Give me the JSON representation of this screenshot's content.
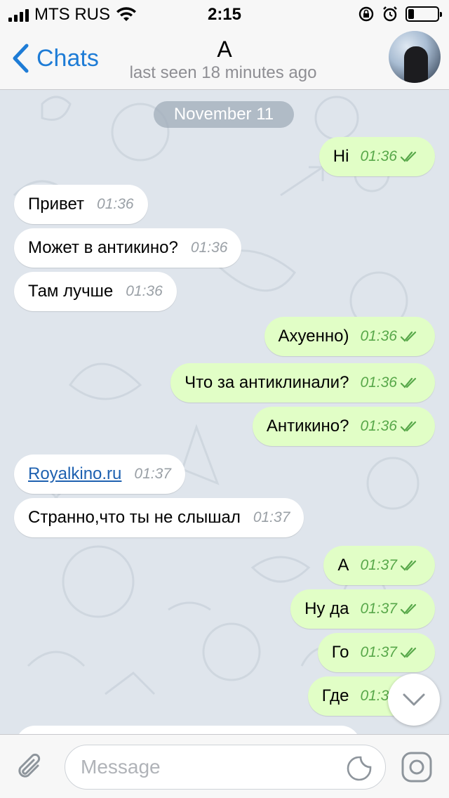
{
  "status_bar": {
    "carrier": "MTS RUS",
    "time": "2:15",
    "wifi_icon": "wifi-icon",
    "rotation_lock_icon": "rotation-lock-icon",
    "alarm_icon": "alarm-icon",
    "battery_level": 0.2
  },
  "nav": {
    "back_label": "Chats",
    "title": "А",
    "subtitle": "last seen 18 minutes ago"
  },
  "date_separator": "November 11",
  "messages": [
    {
      "dir": "out",
      "text": "Hi",
      "time": "01:36",
      "read": true
    },
    {
      "dir": "in",
      "text": "Привет",
      "time": "01:36"
    },
    {
      "dir": "in",
      "text": "Может в антикино?",
      "time": "01:36"
    },
    {
      "dir": "in",
      "text": "Там лучше",
      "time": "01:36"
    },
    {
      "dir": "out",
      "text": "Ахуенно)",
      "time": "01:36",
      "read": true
    },
    {
      "dir": "out",
      "text": "Что за антиклинали?",
      "time": "01:36",
      "read": true
    },
    {
      "dir": "out",
      "text": "Антикино?",
      "time": "01:36",
      "read": true
    },
    {
      "dir": "in",
      "text": "Royalkino.ru",
      "time": "01:37",
      "link": true
    },
    {
      "dir": "in",
      "text": "Странно,что ты не слышал",
      "time": "01:37"
    },
    {
      "dir": "out",
      "text": "А",
      "time": "01:37",
      "read": true
    },
    {
      "dir": "out",
      "text": "Ну да",
      "time": "01:37",
      "read": true
    },
    {
      "dir": "out",
      "text": "Го",
      "time": "01:37",
      "read": true
    },
    {
      "dir": "out",
      "text": "Где",
      "time": "01:37",
      "read": true
    }
  ],
  "input": {
    "placeholder": "Message",
    "value": ""
  },
  "colors": {
    "accent": "#1e7cd6",
    "outgoing_bubble": "#e1fec6",
    "incoming_bubble": "#ffffff",
    "read_checks": "#58a84a",
    "chat_background": "#dfe5ec"
  }
}
